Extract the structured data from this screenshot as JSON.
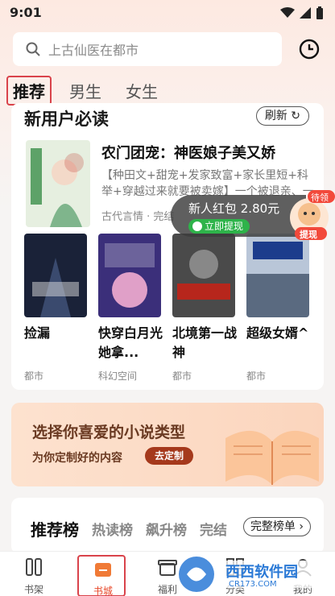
{
  "status": {
    "time": "9:01"
  },
  "search": {
    "placeholder": "上古仙医在都市"
  },
  "tabs": [
    {
      "label": "推荐"
    },
    {
      "label": "男生"
    },
    {
      "label": "女生"
    }
  ],
  "new_user": {
    "title": "新用户必读",
    "refresh_label": "刷新",
    "featured": {
      "title": "农门团宠：神医娘子美又娇",
      "desc": "【种田文+甜宠+发家致富+家长里短+科举+穿越过来就要被卖嫁】一个被退亲、一个穷",
      "tag": "古代言情 · 完结"
    },
    "books": [
      {
        "name": "捡漏",
        "cat": "都市"
      },
      {
        "name": "快穿白月光她拿...",
        "cat": "科幻空间"
      },
      {
        "name": "北境第一战神",
        "cat": "都市"
      },
      {
        "name": "超级女婿^",
        "cat": "都市"
      }
    ]
  },
  "redpack": {
    "amount": "新人红包 2.80元",
    "button": "立即提现",
    "badge_top": "待领",
    "badge_bottom": "提现"
  },
  "banner": {
    "title": "选择你喜爱的小说类型",
    "subtitle": "为你定制好的内容",
    "button": "去定制"
  },
  "ranking": {
    "tabs": [
      "推荐榜",
      "热读榜",
      "飙升榜",
      "完结"
    ],
    "full_label": "完整榜单"
  },
  "bottom_nav": [
    {
      "label": "书架"
    },
    {
      "label": "书城"
    },
    {
      "label": "福利"
    },
    {
      "label": "分类"
    },
    {
      "label": "我的"
    }
  ],
  "watermark": {
    "text": "西西软件园",
    "site": "CR173.COM"
  },
  "colors": {
    "accent": "#e8492b",
    "highlight_border": "#d9434b"
  }
}
